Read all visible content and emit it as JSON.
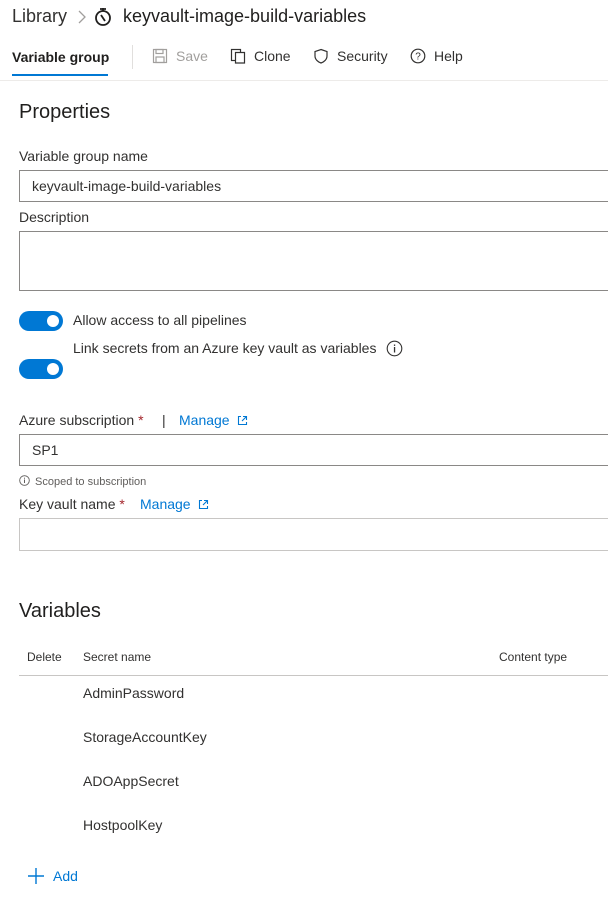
{
  "breadcrumb": {
    "root": "Library",
    "title": "keyvault-image-build-variables"
  },
  "tabs": {
    "active": "Variable group"
  },
  "toolbar": {
    "save": "Save",
    "clone": "Clone",
    "security": "Security",
    "help": "Help"
  },
  "properties": {
    "heading": "Properties",
    "group_name_label": "Variable group name",
    "group_name_value": "keyvault-image-build-variables",
    "description_label": "Description",
    "description_value": "",
    "allow_access_label": "Allow access to all pipelines",
    "allow_access_on": true,
    "link_secrets_label": "Link secrets from an Azure key vault as variables",
    "link_secrets_on": true,
    "subscription_label": "Azure subscription",
    "required_mark": "*",
    "divider": "|",
    "manage_label": "Manage",
    "subscription_value": "SP1",
    "scope_note": "Scoped to subscription",
    "keyvault_label": "Key vault name",
    "keyvault_value": ""
  },
  "variables": {
    "heading": "Variables",
    "columns": {
      "delete": "Delete",
      "secret_name": "Secret name",
      "content_type": "Content type"
    },
    "rows": [
      "AdminPassword",
      "StorageAccountKey",
      "ADOAppSecret",
      "HostpoolKey"
    ],
    "add_label": "Add"
  },
  "colors": {
    "accent": "#0078d4",
    "required": "#a4262c",
    "text": "#323130"
  }
}
